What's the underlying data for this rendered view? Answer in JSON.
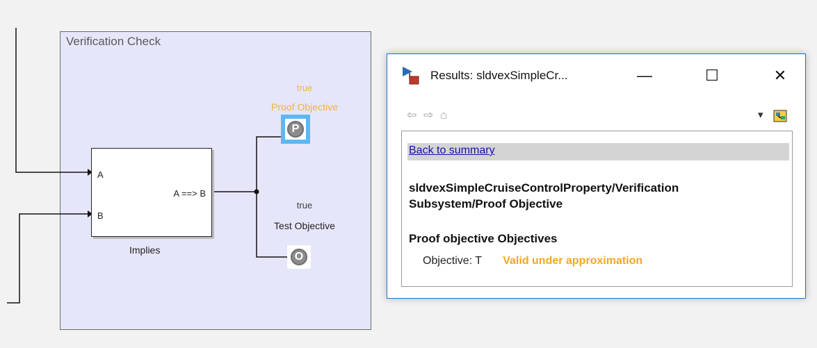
{
  "model": {
    "subsystem_title": "Verification Check",
    "block": {
      "port_a": "A",
      "port_b": "B",
      "output_label": "A ==> B",
      "caption": "Implies"
    },
    "proof_objective": {
      "value": "true",
      "name": "Proof Objective",
      "glyph": "P",
      "color": "#f5b041"
    },
    "test_objective": {
      "value": "true",
      "name": "Test Objective",
      "glyph": "O",
      "color": "#404040"
    }
  },
  "results_window": {
    "title": "Results: sldvexSimpleCr...",
    "controls": {
      "minimize": "—",
      "maximize": "☐",
      "close": "✕"
    },
    "toolbar": {
      "back_icon": "⇦",
      "forward_icon": "⇨",
      "home_icon": "⌂",
      "dropdown_icon": "▾"
    },
    "back_link": "Back to summary",
    "path_line1": "sldvexSimpleCruiseControlProperty/Verification",
    "path_line2": "Subsystem/Proof Objective",
    "section_heading": "Proof objective Objectives",
    "objective_label": "Objective: T",
    "objective_status": "Valid under approximation",
    "status_color": "#f5a623"
  }
}
